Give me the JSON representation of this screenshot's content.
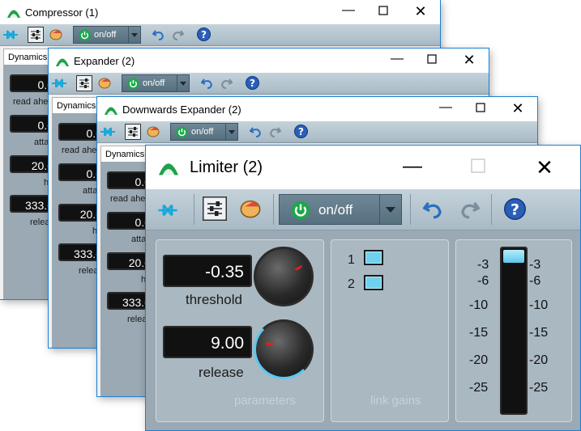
{
  "windows": [
    {
      "id": "compressor",
      "title": "Compressor (1)",
      "tab": "Dynamics",
      "onoff": "on/off",
      "rows": [
        {
          "value": "0.0",
          "label": "read ahe"
        },
        {
          "value": "0.0",
          "label": "atta"
        },
        {
          "value": "20.0",
          "label": "ho"
        },
        {
          "value": "333.0",
          "label": "relea"
        }
      ]
    },
    {
      "id": "expander",
      "title": "Expander (2)",
      "tab": "Dynamics",
      "onoff": "on/off",
      "rows": [
        {
          "value": "0.0",
          "label": "read ahe"
        },
        {
          "value": "0.0",
          "label": "atta"
        },
        {
          "value": "20.0",
          "label": "ho"
        },
        {
          "value": "333.0",
          "label": "relea"
        }
      ]
    },
    {
      "id": "downexp",
      "title": "Downwards Expander (2)",
      "tab": "Dynamics",
      "onoff": "on/off",
      "rows": [
        {
          "value": "0.0",
          "label": "read ahe"
        },
        {
          "value": "0.0",
          "label": "atta"
        },
        {
          "value": "20.0",
          "label": "ho"
        },
        {
          "value": "333.0",
          "label": "relea"
        }
      ]
    }
  ],
  "limiter": {
    "title": "Limiter (2)",
    "onoff": "on/off",
    "threshold": {
      "value": "-0.35",
      "label": "threshold"
    },
    "release": {
      "value": "9.00",
      "label": "release"
    },
    "parameters_label": "parameters",
    "link_gains_label": "link gains",
    "link_gains": [
      {
        "label": "1",
        "checked": true
      },
      {
        "label": "2",
        "checked": true
      }
    ],
    "meter_ticks": [
      "-3",
      "-6",
      "-10",
      "-15",
      "-20",
      "-25"
    ]
  },
  "colors": {
    "accent": "#1e7fd0",
    "checkbox": "#6fd0ef",
    "panel": "#aab8c1",
    "power_green": "#1ba84a"
  }
}
